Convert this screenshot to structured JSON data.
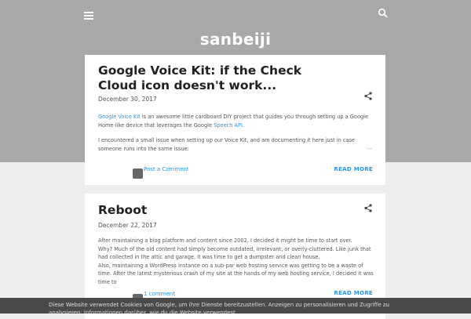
{
  "header": {
    "blog_title": "sanbeiji",
    "menu_icon": "menu-icon",
    "search_icon": "search-icon"
  },
  "colors": {
    "header_bg": "#a8a8a8",
    "page_bg": "#eeeeee",
    "link": "#2196f3",
    "cookie_bar_bg": "#4a4a4a"
  },
  "posts": [
    {
      "title": "Google Voice Kit: if the Check Cloud icon doesn't work...",
      "date": "December 30, 2017",
      "snippet": {
        "p1_link1": "Google Voice Kit",
        "p1_text1": " is an awesome little cardboard DIY project that guides you through setting up a Google Home-like device that leverages the Google ",
        "p1_link2": "Speech API",
        "p1_text2": ".",
        "p2": "I encountered a small issue when setting up our Voice Kit, and am documenting it here just in case someone runs into the same issue:"
      },
      "ellipsis": "…",
      "comment_label": "Post a Comment",
      "read_more": "READ MORE"
    },
    {
      "title": "Reboot",
      "date": "December 22, 2017",
      "snippet": {
        "line1": "After maintaining a blog platform and content since 2002, I decided it might be time to start over.",
        "line2": "Why? Much of the old content had simply become outdated, irrelevant, or overly-cluttered. Like junk that had collected in the attic and garage, it was time to get a dumpster and clean house.",
        "line3": "Also, maintaining a WordPress instance on a sub-par web hosting service was getting to be a waste of time. After the latest mysterious crash of my site at the hands of my web hosting service, I decided it was time to"
      },
      "ellipsis": "…",
      "comment_label": "1 comment",
      "read_more": "READ MORE"
    }
  ],
  "cookie_bar": {
    "text": "Diese Website verwendet Cookies von Google, um ihre Dienste bereitzustellen. Anzeigen zu personalisieren und Zugriffe zu analysieren. Informationen darüber, wie du die Website verwendest,"
  }
}
